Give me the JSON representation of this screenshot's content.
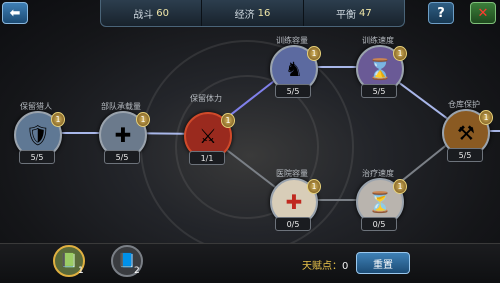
{
  "header": {
    "stats": [
      {
        "label": "战斗",
        "value": "60"
      },
      {
        "label": "经济",
        "value": "16"
      },
      {
        "label": "平衡",
        "value": "47"
      }
    ],
    "help_label": "?",
    "close_label": "✕"
  },
  "nodes": [
    {
      "label": "保留猎人",
      "level": "5/5",
      "badge": "1",
      "icon": "knight-arrow-icon",
      "color": "#5f7894"
    },
    {
      "label": "部队承载量",
      "level": "5/5",
      "badge": "1",
      "icon": "knight-plus-icon",
      "color": "#6b7a8c"
    },
    {
      "label": "保留体力",
      "level": "1/1",
      "badge": "1",
      "icon": "golden-warrior-icon",
      "color": "#9a2a1e"
    },
    {
      "label": "训练容量",
      "level": "5/5",
      "badge": "1",
      "icon": "soldiers-icon",
      "color": "#5c6aa0"
    },
    {
      "label": "训练速度",
      "level": "5/5",
      "badge": "1",
      "icon": "hourglass-knight-icon",
      "color": "#6a5a96"
    },
    {
      "label": "仓库保护",
      "level": "5/5",
      "badge": "1",
      "icon": "warehouse-icon",
      "color": "#8a5a22"
    },
    {
      "label": "医院容量",
      "level": "0/5",
      "badge": "1",
      "icon": "medkit-icon",
      "color": "#d8cdb8"
    },
    {
      "label": "治疗速度",
      "level": "0/5",
      "badge": "1",
      "icon": "hourglass-icon",
      "color": "#b9b4ae"
    }
  ],
  "footer": {
    "tabs": [
      "1",
      "2"
    ],
    "talent_label": "天赋点：",
    "talent_value": "0",
    "reset_label": "重置"
  }
}
